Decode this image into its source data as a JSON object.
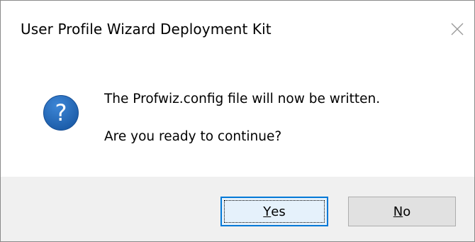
{
  "dialog": {
    "title": "User Profile Wizard Deployment Kit",
    "close_icon": "close-icon",
    "icon": "question-icon",
    "icon_glyph": "?",
    "message_line1": "The Profwiz.config file will now be written.",
    "message_line2": "Are you ready to continue?",
    "buttons": {
      "yes_accel": "Y",
      "yes_rest": "es",
      "no_accel": "N",
      "no_rest": "o"
    }
  },
  "colors": {
    "footer_bg": "#f0f0f0",
    "icon_blue": "#1d5fae",
    "focus_border": "#0078d7",
    "button_bg": "#e1e1e1"
  }
}
